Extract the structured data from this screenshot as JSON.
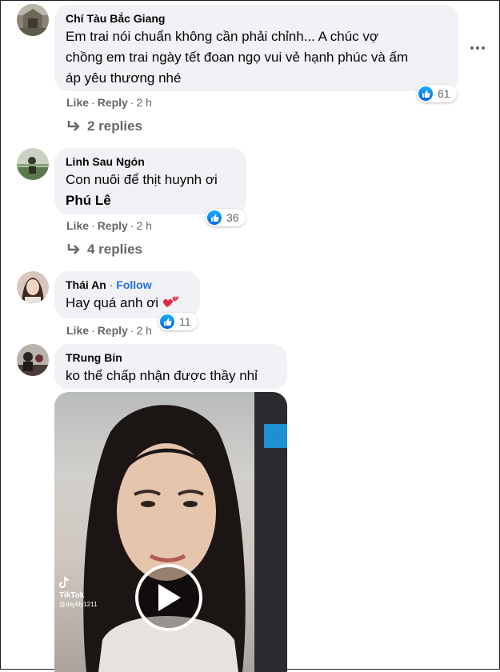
{
  "comments": [
    {
      "author": "Chí Tàu Bắc Giang",
      "lines": [
        "Em trai nói chuẩn không cần phải chỉnh... A chúc vợ",
        "chồng em trai ngày tết đoan ngọ vui vẻ hạnh phúc và ấm",
        "áp yêu thương nhé"
      ],
      "like": "Like",
      "reply": "Reply",
      "time": "2 h",
      "reactions": "61",
      "replies": "2 replies"
    },
    {
      "author": "Linh Sau Ngón",
      "lines": [
        "Con nuôi để thịt huynh ơi"
      ],
      "mention": "Phú Lê",
      "like": "Like",
      "reply": "Reply",
      "time": "2 h",
      "reactions": "36",
      "replies": "4 replies"
    },
    {
      "author": "Thái An",
      "follow": "Follow",
      "lines": [
        "Hay quá anh ơi"
      ],
      "like": "Like",
      "reply": "Reply",
      "time": "2 h",
      "reactions": "11"
    },
    {
      "author": "TRung Bin",
      "lines": [
        "ko thể chấp nhận được thầy nhỉ"
      ],
      "video": {
        "brand": "TikTok",
        "handle": "@daylily1211"
      }
    }
  ],
  "icons": [
    "avatar",
    "more-options-icon",
    "like-reaction-icon",
    "reply-arrow-icon",
    "heart-emoji-icon",
    "play-icon",
    "tiktok-logo-icon"
  ],
  "colors": {
    "link": "#216fdb",
    "muted": "#65676b",
    "bubble": "#f0f2f5",
    "like": "#0866ff"
  }
}
